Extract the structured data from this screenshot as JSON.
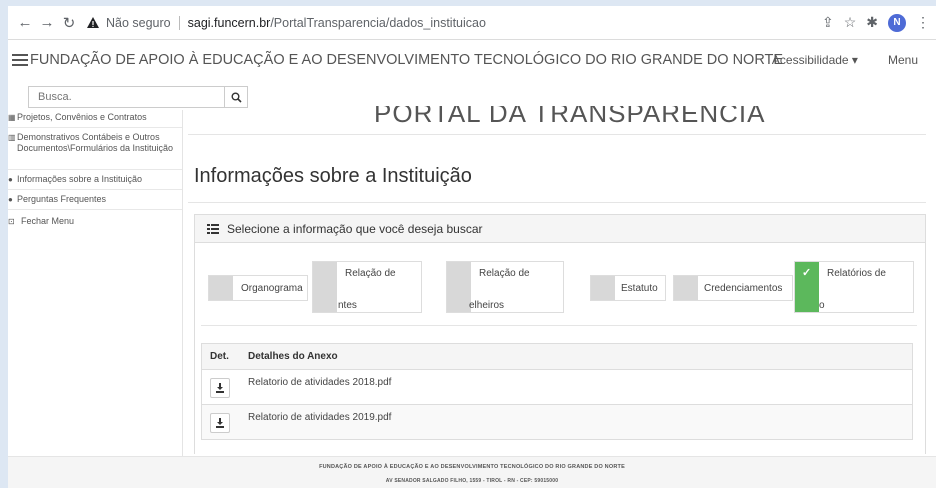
{
  "browser": {
    "insecure_label": "Não seguro",
    "url_domain": "sagi.funcern.br",
    "url_path": "/PortalTransparencia/dados_instituicao",
    "profile_initial": "N"
  },
  "header": {
    "title": "FUNDAÇÃO DE APOIO À EDUCAÇÃO E AO DESENVOLVIMENTO TECNOLÓGICO DO RIO GRANDE DO NORTE",
    "accessibility": "Acessibilidade ▾",
    "menu": "Menu"
  },
  "search": {
    "placeholder": "Busca."
  },
  "sidebar": {
    "items": [
      {
        "icon": "map-icon",
        "label": "Projetos, Convênios e Contratos"
      },
      {
        "icon": "chart-icon",
        "label": "Demonstrativos Contábeis e Outros Documentos\\Formulários da Instituição"
      },
      {
        "icon": "info-icon",
        "label": "Informações sobre a Instituição"
      },
      {
        "icon": "question-icon",
        "label": "Perguntas Frequentes"
      },
      {
        "icon": "close-box-icon",
        "label": "Fechar Menu"
      }
    ]
  },
  "main": {
    "portal_title": "PORTAL DA TRANSPARÊNCIA",
    "page_title": "Informações sobre a Instituição",
    "panel_title": "Selecione a informação que você deseja buscar",
    "tabs": [
      {
        "label": "Organograma",
        "active": false
      },
      {
        "label_top": "Relação de",
        "label_bottom": "ntes",
        "active": false
      },
      {
        "label_top": "Relação de",
        "label_bottom": "elheiros",
        "active": false
      },
      {
        "label": "Estatuto",
        "active": false
      },
      {
        "label": "Credenciamentos",
        "active": false
      },
      {
        "label_top": "Relatórios de",
        "label_bottom": "o",
        "active": true
      }
    ],
    "table": {
      "headers": [
        "Det.",
        "Detalhes do Anexo"
      ],
      "rows": [
        {
          "name": "Relatorio de atividades 2018.pdf"
        },
        {
          "name": "Relatorio de atividades 2019.pdf"
        }
      ]
    }
  },
  "footer": {
    "line1": "FUNDAÇÃO DE APOIO À EDUCAÇÃO E AO DESENVOLVIMENTO TECNOLÓGICO DO RIO GRANDE DO NORTE",
    "line2": "AV SENADOR SALGADO FILHO, 1559 - TIROL - RN - CEP: 59015000"
  },
  "colors": {
    "active_tab": "#5cb85c",
    "inactive_tab_bar": "#d8d8d8",
    "profile": "#4e6bd6"
  }
}
